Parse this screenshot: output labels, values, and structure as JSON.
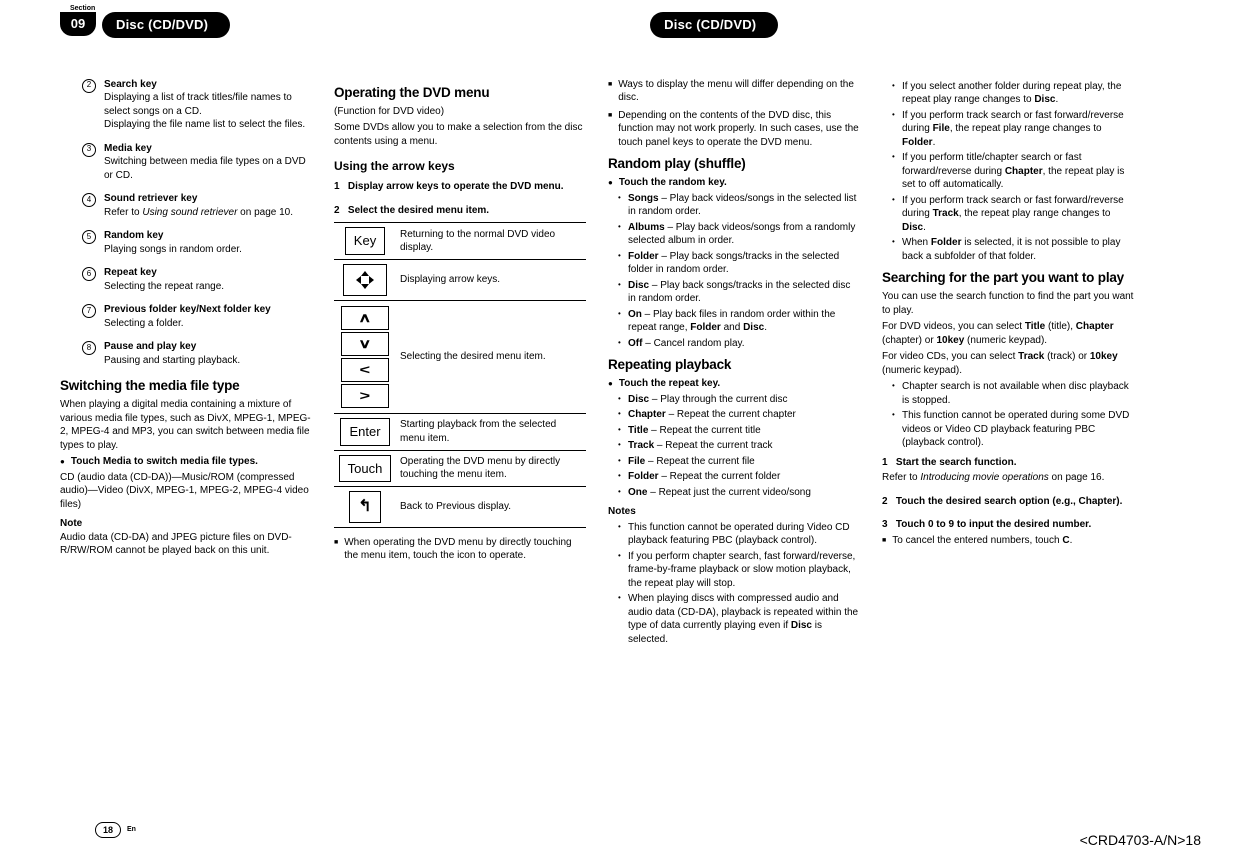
{
  "header": {
    "section_label": "Section",
    "section_number": "09",
    "tab_left": "Disc (CD/DVD)",
    "tab_right": "Disc (CD/DVD)"
  },
  "col1": {
    "items": [
      {
        "num": "2",
        "title": "Search key",
        "desc": "Displaying a list of track titles/file names to select songs on a CD.\nDisplaying the file name list to select the files."
      },
      {
        "num": "3",
        "title": "Media key",
        "desc": "Switching between media file types on a DVD or CD."
      },
      {
        "num": "4",
        "title": "Sound retriever key",
        "desc_prefix": "Refer to ",
        "desc_italic": "Using sound retriever",
        "desc_suffix": " on page 10."
      },
      {
        "num": "5",
        "title": "Random key",
        "desc": "Playing songs in random order."
      },
      {
        "num": "6",
        "title": "Repeat key",
        "desc": "Selecting the repeat range."
      },
      {
        "num": "7",
        "title": "Previous folder key/Next folder key",
        "desc": "Selecting a folder."
      },
      {
        "num": "8",
        "title": "Pause and play key",
        "desc": "Pausing and starting playback."
      }
    ],
    "h_switch": "Switching the media file type",
    "switch_p": "When playing a digital media containing a mixture of various media file types, such as DivX, MPEG-1, MPEG-2, MPEG-4 and MP3, you can switch between media file types to play.",
    "switch_step": "Touch Media to switch media file types.",
    "switch_detail": "CD (audio data (CD-DA))—Music/ROM (compressed audio)—Video (DivX, MPEG-1, MPEG-2, MPEG-4 video files)",
    "note_head": "Note",
    "note_body": "Audio data (CD-DA) and JPEG picture files on DVD-R/RW/ROM cannot be played back on this unit."
  },
  "col2": {
    "h_op": "Operating the DVD menu",
    "op_sub": "(Function for DVD video)",
    "op_p": "Some DVDs allow you to make a selection from the disc contents using a menu.",
    "h_arrow": "Using the arrow keys",
    "step1_n": "1",
    "step1": "Display arrow keys to operate the DVD menu.",
    "step2_n": "2",
    "step2": "Select the desired menu item.",
    "rows": {
      "key": "Key",
      "key_d": "Returning to the normal DVD video display.",
      "arrows_d": "Displaying arrow keys.",
      "sel_d": "Selecting the desired menu item.",
      "enter": "Enter",
      "enter_d": "Starting playback from the selected menu item.",
      "touch": "Touch",
      "touch_d": "Operating the DVD menu by directly touching the menu item.",
      "back_d": "Back to Previous display."
    },
    "sq1": "When operating the DVD menu by directly touching the menu item, touch the icon to operate."
  },
  "col3": {
    "sq1": "Ways to display the menu will differ depending on the disc.",
    "sq2": "Depending on the contents of the DVD disc, this function may not work properly. In such cases, use the touch panel keys to operate the DVD menu.",
    "h_random": "Random play (shuffle)",
    "random_lead": "Touch the random key.",
    "random_items": [
      {
        "k": "Songs",
        "d": " – Play back videos/songs in the selected list in random order."
      },
      {
        "k": "Albums",
        "d": " – Play back videos/songs from a randomly selected album in order."
      },
      {
        "k": "Folder",
        "d": " – Play back songs/tracks in the selected folder in random order."
      },
      {
        "k": "Disc",
        "d": " – Play back songs/tracks in the selected disc in random order."
      },
      {
        "k": "On",
        "d_pre": " – Play back files in random order within the repeat range, ",
        "d_b1": "Folder",
        "d_mid": " and ",
        "d_b2": "Disc",
        "d_post": "."
      },
      {
        "k": "Off",
        "d": " – Cancel random play."
      }
    ],
    "h_repeat": "Repeating playback",
    "repeat_lead": "Touch the repeat key.",
    "repeat_items": [
      {
        "k": "Disc",
        "d": " – Play through the current disc"
      },
      {
        "k": "Chapter",
        "d": " – Repeat the current chapter"
      },
      {
        "k": "Title",
        "d": " – Repeat the current title"
      },
      {
        "k": "Track",
        "d": " – Repeat the current track"
      },
      {
        "k": "File",
        "d": " – Repeat the current file"
      },
      {
        "k": "Folder",
        "d": " – Repeat the current folder"
      },
      {
        "k": "One",
        "d": " – Repeat just the current video/song"
      }
    ],
    "notes_head": "Notes",
    "notes": [
      "This function cannot be operated during Video CD playback featuring PBC (playback control).",
      "If you perform chapter search, fast forward/reverse, frame-by-frame playback or slow motion playback, the repeat play will stop."
    ],
    "note3_pre": "When playing discs with compressed audio and audio data (CD-DA), playback is repeated within the type of data currently playing even if ",
    "note3_b": "Disc",
    "note3_post": " is selected."
  },
  "col4": {
    "bullets": [
      {
        "pre": "If you select another folder during repeat play, the repeat play range changes to ",
        "b": "Disc",
        "post": "."
      },
      {
        "pre": "If you perform track search or fast forward/reverse during ",
        "b": "File",
        "mid": ", the repeat play range changes to ",
        "b2": "Folder",
        "post": "."
      },
      {
        "pre": "If you perform title/chapter search or fast forward/reverse during ",
        "b": "Chapter",
        "post": ", the repeat play is set to off automatically."
      },
      {
        "pre": "If you perform track search or fast forward/reverse during ",
        "b": "Track",
        "mid": ", the repeat play range changes to ",
        "b2": "Disc",
        "post": "."
      },
      {
        "pre": "When ",
        "b": "Folder",
        "post": " is selected, it is not possible to play back a subfolder of that folder."
      }
    ],
    "h_search": "Searching for the part you want to play",
    "s_p1": "You can use the search function to find the part you want to play.",
    "s_p2_pre": "For DVD videos, you can select ",
    "s_p2_b1": "Title",
    "s_p2_m1": " (title), ",
    "s_p2_b2": "Chapter",
    "s_p2_m2": " (chapter) or ",
    "s_p2_b3": "10key",
    "s_p2_m3": " (numeric keypad).",
    "s_p3_pre": "For video CDs, you can select ",
    "s_p3_b1": "Track",
    "s_p3_m1": " (track) or ",
    "s_p3_b2": "10key",
    "s_p3_m2": " (numeric keypad).",
    "s_bul1": "Chapter search is not available when disc playback is stopped.",
    "s_bul2": "This function cannot be operated during some DVD videos or Video CD playback featuring PBC (playback control).",
    "step1_n": "1",
    "step1": "Start the search function.",
    "step1_ref_pre": "Refer to ",
    "step1_ref_i": "Introducing movie operations",
    "step1_ref_post": " on page 16.",
    "step2_n": "2",
    "step2": "Touch the desired search option (e.g., Chapter).",
    "step3_n": "3",
    "step3": "Touch 0 to 9 to input the desired number.",
    "step3_note_pre": "To cancel the entered numbers, touch ",
    "step3_note_b": "C",
    "step3_note_post": "."
  },
  "footer": {
    "page": "18",
    "lang": "En",
    "code": "<CRD4703-A/N>18"
  }
}
